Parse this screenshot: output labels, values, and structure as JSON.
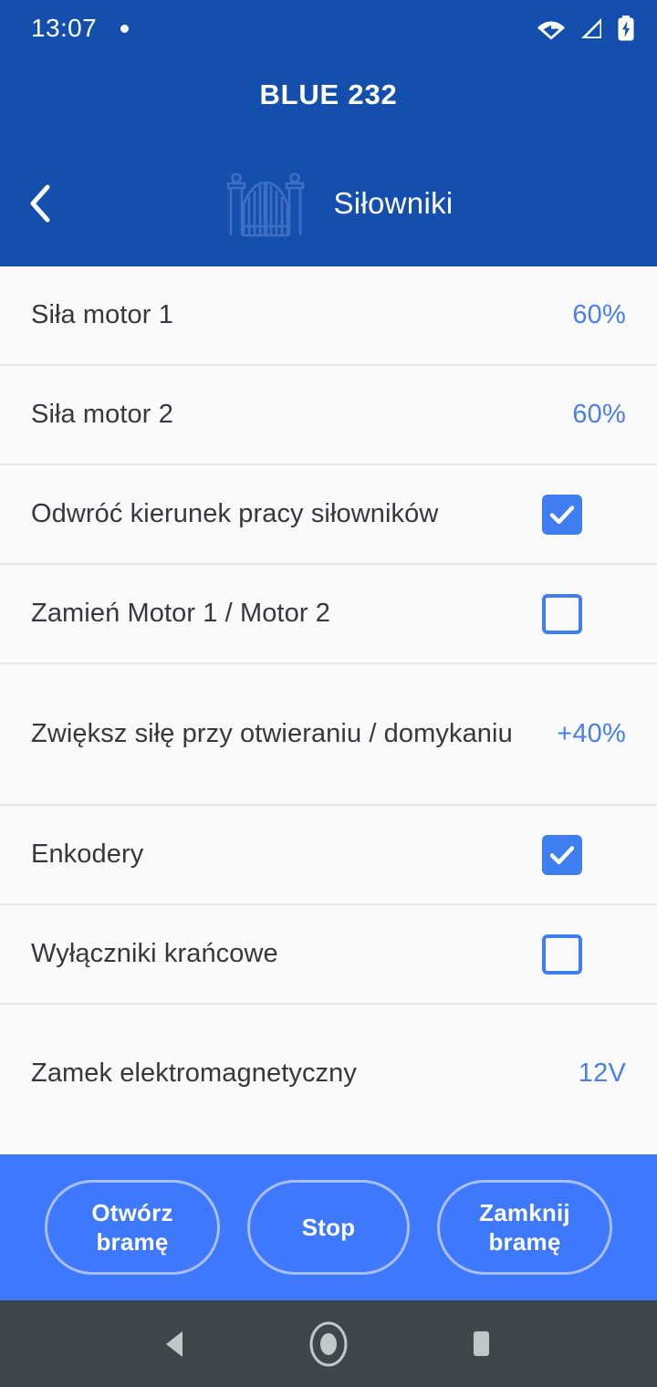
{
  "status_bar": {
    "time": "13:07",
    "notification_dot": "•",
    "icons": [
      "wifi-icon",
      "cellular-signal-icon",
      "battery-charging-icon"
    ]
  },
  "header": {
    "app_title": "BLUE 232",
    "back_label": "‹",
    "section_icon": "gate-icon",
    "section_title": "Siłowniki",
    "background_color": "#144fae"
  },
  "settings_rows": [
    {
      "label": "Siła motor 1",
      "type": "value",
      "value": "60%"
    },
    {
      "label": "Siła motor 2",
      "type": "value",
      "value": "60%"
    },
    {
      "label": "Odwróć kierunek pracy siłowników",
      "type": "checkbox",
      "checked": true
    },
    {
      "label": "Zamień Motor 1 / Motor 2",
      "type": "checkbox",
      "checked": false
    },
    {
      "label": "Zwiększ siłę przy otwieraniu / domykaniu",
      "type": "value",
      "value": "+40%"
    },
    {
      "label": "Enkodery",
      "type": "checkbox",
      "checked": true
    },
    {
      "label": "Wyłączniki krańcowe",
      "type": "checkbox",
      "checked": false
    },
    {
      "label": "Zamek elektromagnetyczny",
      "type": "value",
      "value": "12V"
    }
  ],
  "action_bar": {
    "background_color": "#3e78fc",
    "buttons": [
      {
        "label": "Otwórz\nbramę",
        "name": "open-gate-button"
      },
      {
        "label": "Stop",
        "name": "stop-button"
      },
      {
        "label": "Zamknij\nbramę",
        "name": "close-gate-button"
      }
    ]
  },
  "nav_bar": {
    "background_color": "#40474c",
    "buttons": [
      "back-nav-icon",
      "home-nav-icon",
      "recents-nav-icon"
    ]
  },
  "colors": {
    "header_blue": "#144fae",
    "accent_blue": "#3f7ef0",
    "value_blue": "#4a7fe8",
    "list_background": "#fafafa",
    "divider": "#e6e6e6"
  }
}
